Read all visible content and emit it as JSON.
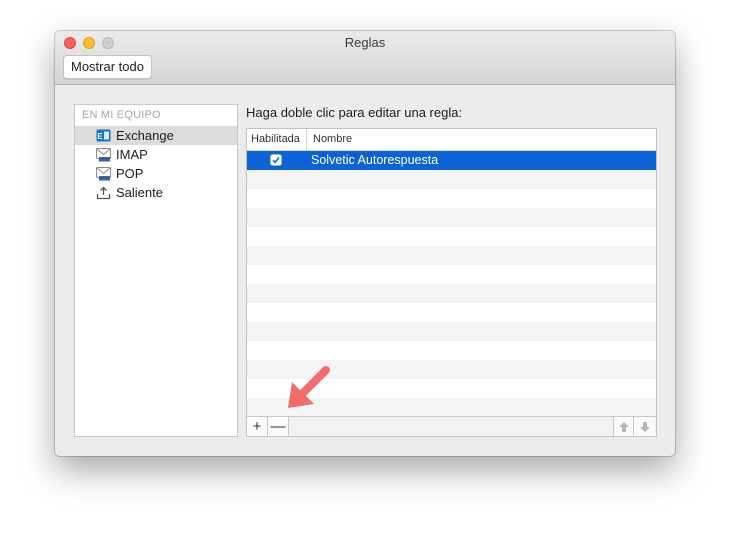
{
  "window": {
    "title": "Reglas"
  },
  "toolbar": {
    "show_all_label": "Mostrar todo"
  },
  "sidebar": {
    "header": "EN MI EQUIPO",
    "items": [
      {
        "label": "Exchange",
        "icon": "exchange-icon",
        "selected": true
      },
      {
        "label": "IMAP",
        "icon": "imap-mail-icon",
        "selected": false
      },
      {
        "label": "POP",
        "icon": "pop-mail-icon",
        "selected": false
      },
      {
        "label": "Saliente",
        "icon": "outgoing-upload-icon",
        "selected": false
      }
    ]
  },
  "main": {
    "instruction": "Haga doble clic para editar una regla:",
    "columns": {
      "enabled": "Habilitada",
      "name": "Nombre"
    },
    "rules": [
      {
        "enabled": true,
        "name": "Solvetic Autorespuesta"
      }
    ],
    "add_label": "+",
    "remove_label": "—"
  },
  "colors": {
    "selection": "#0a62d4",
    "annotation_arrow": "#f36b6b",
    "close": "#fc5f57",
    "minimize": "#fdbc2e",
    "zoom": "#cfcfcf"
  }
}
